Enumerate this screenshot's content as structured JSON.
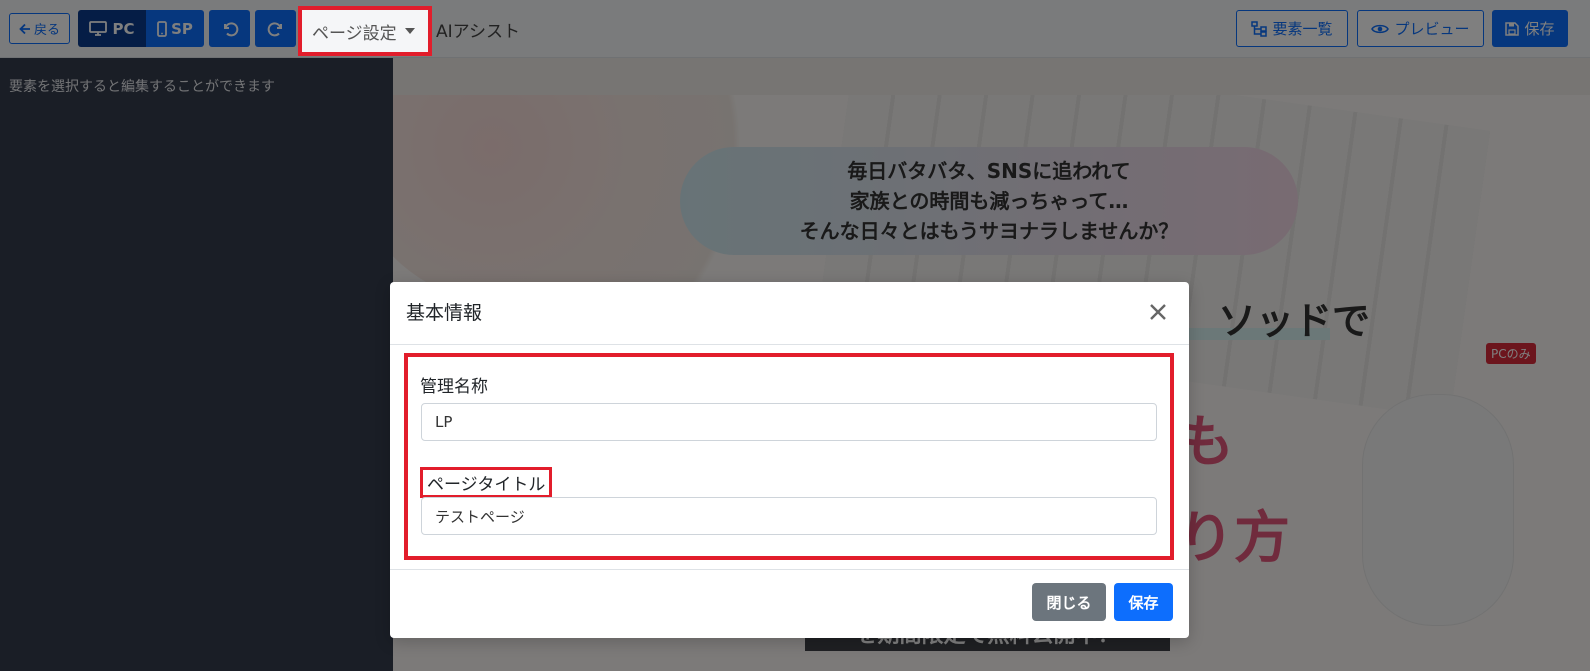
{
  "toolbar": {
    "back_label": "戻る",
    "pc_label": "PC",
    "sp_label": "SP",
    "page_setting_label": "ページ設定",
    "ai_assist_label": "AIアシスト",
    "elements_label": "要素一覧",
    "preview_label": "プレビュー",
    "save_label": "保存"
  },
  "sidebar": {
    "hint": "要素を選択すると編集することができます"
  },
  "canvas": {
    "bubble_lines": [
      "毎日バタバタ、SNSに追われて",
      "家族との時間も減っちゃって…",
      "そんな日々とはもうサヨナラしませんか？"
    ],
    "heading_partial": "ソッドで",
    "pink_partial_1": "も",
    "pink_partial_2": "り方",
    "pc_only_badge": "PCのみ",
    "bottom_band_partial": "を期間限定で無料公開中！"
  },
  "modal": {
    "title": "基本情報",
    "fields": [
      {
        "label": "管理名称",
        "value": "LP"
      },
      {
        "label": "ページタイトル",
        "value": "テストページ"
      }
    ],
    "close_label": "閉じる",
    "save_label": "保存"
  },
  "colors": {
    "primary": "#0d6efd",
    "primary_dark": "#0a3a8c",
    "secondary": "#6c757d",
    "highlight_red": "#e21d2b",
    "sidebar_bg": "#353c4d",
    "pink_text": "#e1567a"
  }
}
